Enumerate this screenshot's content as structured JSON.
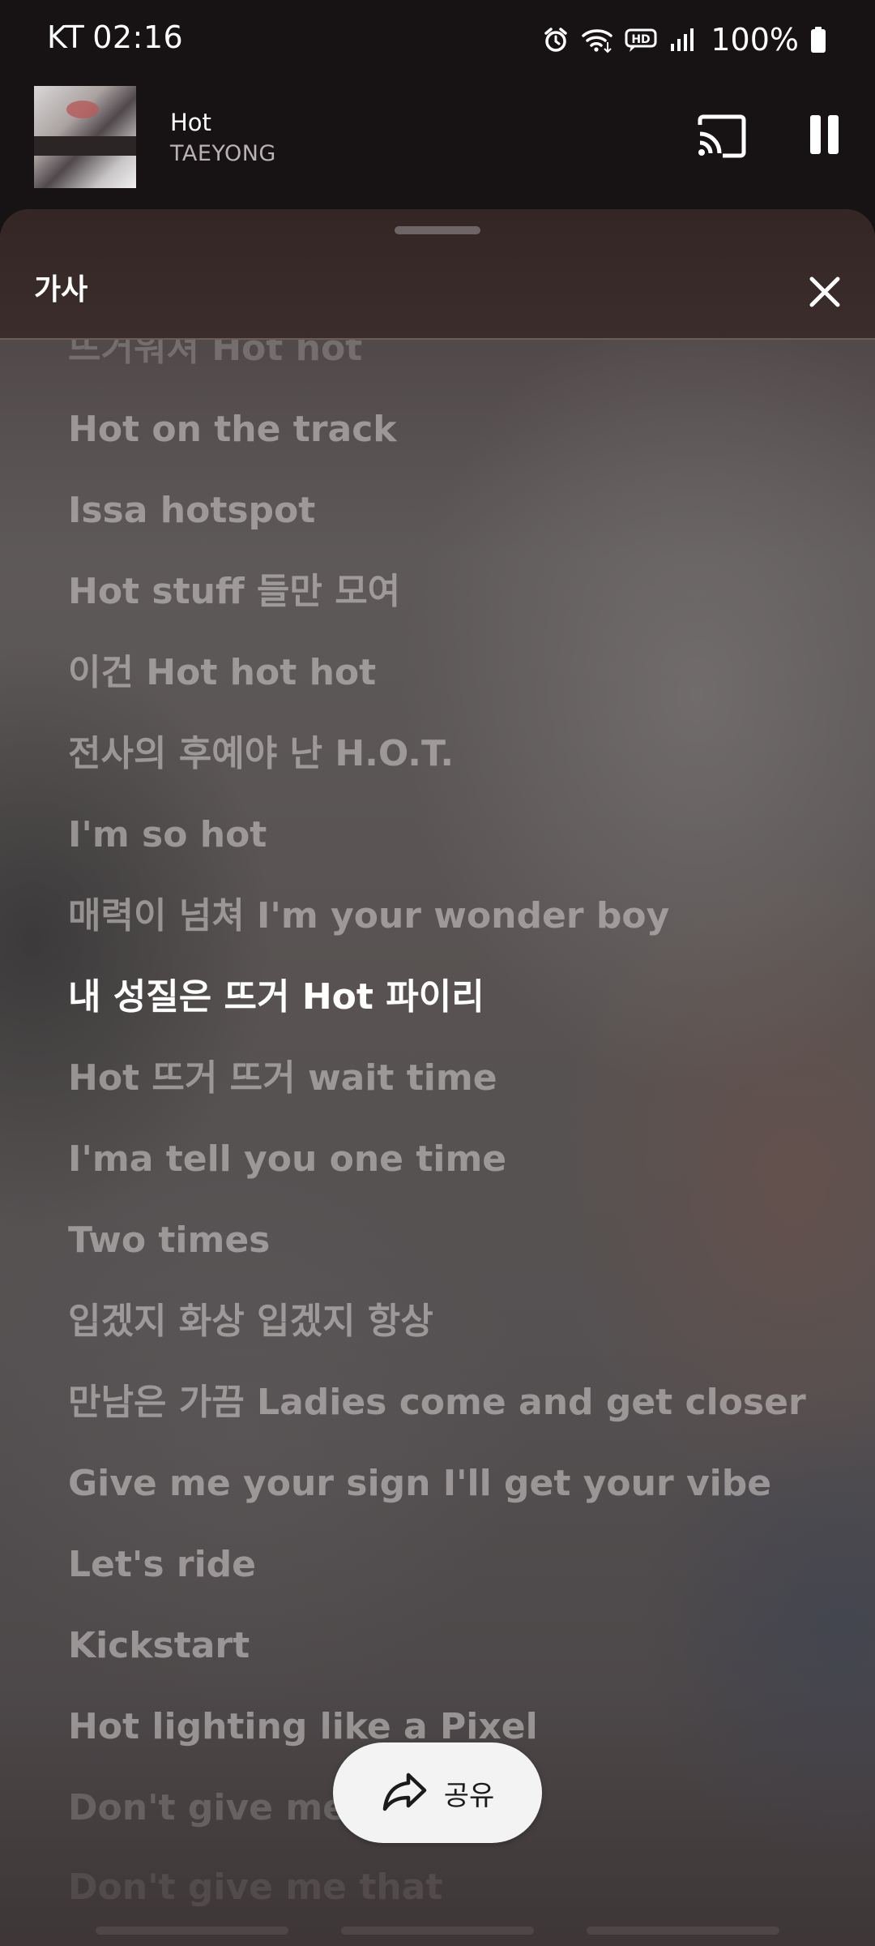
{
  "status_bar": {
    "carrier": "KT",
    "time": "02:16",
    "battery": "100%",
    "icons": [
      "alarm-icon",
      "wifi-icon",
      "hd-voice-icon",
      "signal-icon",
      "battery-icon"
    ]
  },
  "mini_player": {
    "title": "Hot",
    "artist": "TAEYONG",
    "icons": [
      "cast-icon",
      "pause-icon"
    ]
  },
  "lyrics_sheet": {
    "title": "가사",
    "close_icon": "close-icon",
    "lines": [
      "뜨거워져 Hot hot",
      "Hot on the track",
      "Issa hotspot",
      "Hot stuff 들만 모여",
      "이건 Hot hot hot",
      "전사의 후예야 난 H.O.T.",
      "I'm so hot",
      "매력이 넘쳐 I'm your wonder boy",
      "내 성질은 뜨거 Hot 파이리",
      "Hot 뜨거 뜨거 wait time",
      "I'ma tell you one time",
      "Two times",
      "입겠지 화상 입겠지 항상",
      "만남은 가끔 Ladies come and get closer",
      "Give me your sign I'll get your vibe",
      "Let's ride",
      "Kickstart",
      "Hot lighting like a Pixel",
      "Don't give me that",
      "Don't give me that"
    ],
    "active_line_index": 8,
    "share_label": "공유",
    "share_icon": "share-icon"
  },
  "colors": {
    "background": "#171213",
    "sheet_header": "#342624",
    "active_lyric": "#ffffff",
    "inactive_lyric": "#c8c4c4",
    "share_pill": "#f3f3f3"
  }
}
